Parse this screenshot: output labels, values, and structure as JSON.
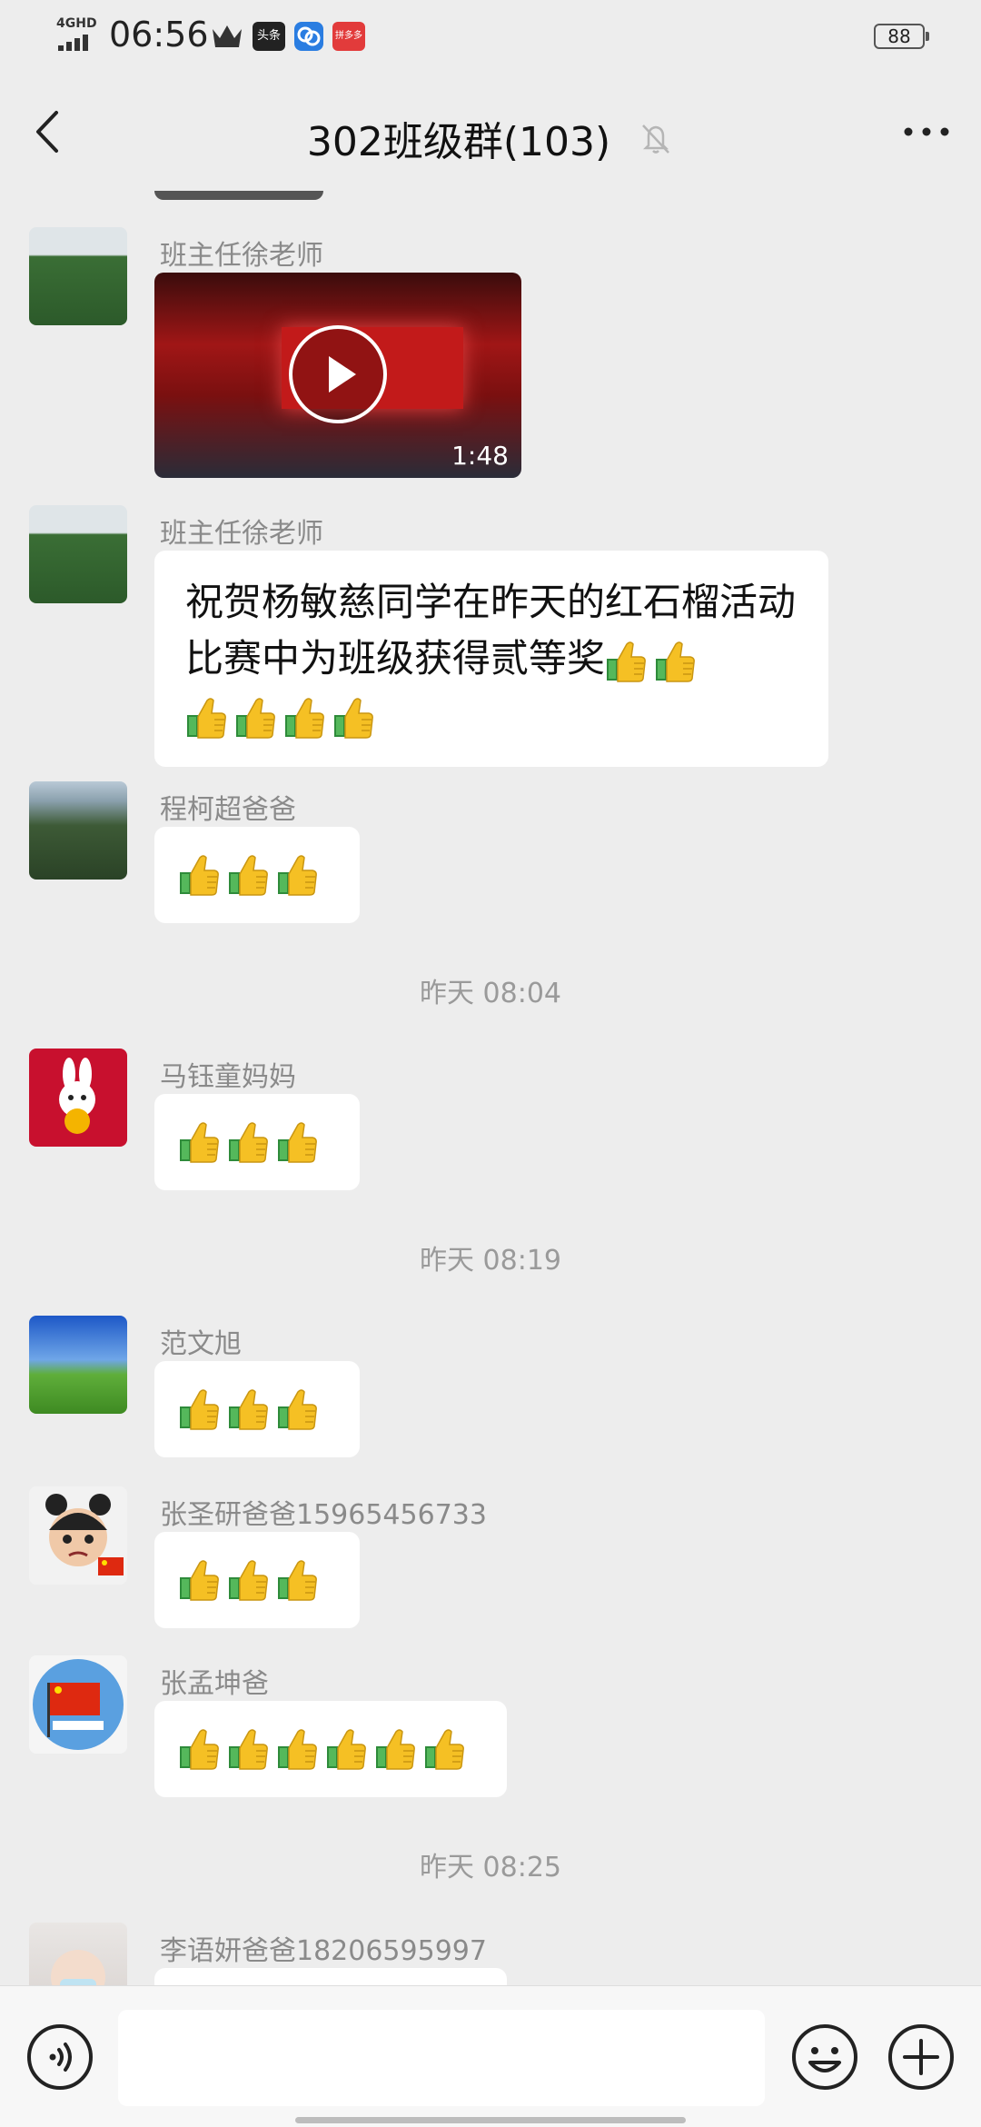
{
  "status_bar": {
    "network": "4GHD",
    "time": "06:56",
    "app_icon_toutiao": "头条",
    "app_icon_other": "拼多多",
    "battery": "88"
  },
  "nav": {
    "title": "302班级群(103)",
    "back_icon": "chevron-left-icon",
    "mute_icon": "bell-muted-icon",
    "more_icon": "more-dots-icon"
  },
  "messages": [
    {
      "sender": "班主任徐老师",
      "type": "video",
      "video_duration": "1:48"
    },
    {
      "sender": "班主任徐老师",
      "type": "text",
      "text": "祝贺杨敏慈同学在昨天的红石榴活动比赛中为班级获得贰等奖"
    },
    {
      "sender": "程柯超爸爸",
      "type": "thumbs",
      "count": 3
    },
    {
      "sender": "马钰童妈妈",
      "type": "thumbs",
      "count": 3
    },
    {
      "sender": "范文旭",
      "type": "thumbs",
      "count": 3
    },
    {
      "sender": "张圣研爸爸15965456733",
      "type": "thumbs",
      "count": 3
    },
    {
      "sender": "张孟坤爸",
      "type": "thumbs",
      "count": 6
    },
    {
      "sender": "李语妍爸爸18206595997",
      "type": "thumbs",
      "count": 0
    }
  ],
  "timestamps": [
    "昨天 08:04",
    "昨天 08:19",
    "昨天 08:25"
  ],
  "composer": {
    "voice_icon": "voice-icon",
    "emoji_icon": "emoji-icon",
    "plus_icon": "plus-icon"
  },
  "colors": {
    "background": "#ededed",
    "bubble": "#ffffff",
    "sender_text": "#8a8a8a"
  }
}
